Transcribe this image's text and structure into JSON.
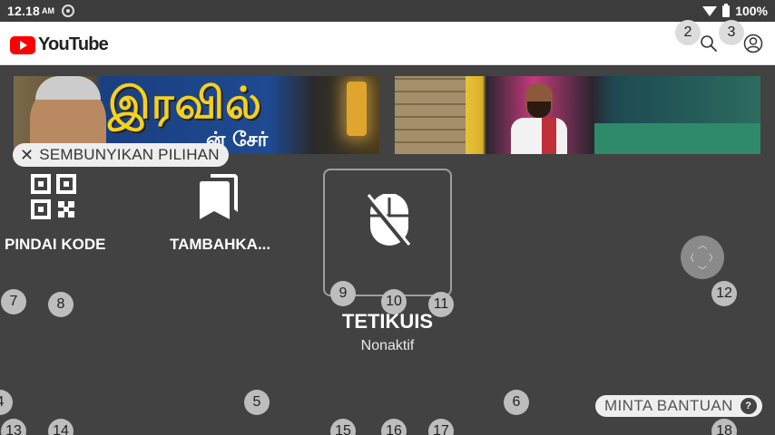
{
  "status_bar": {
    "time": "12.18",
    "ampm": "AM",
    "battery": "100%"
  },
  "app": {
    "logo_text": "YouTube",
    "icons": [
      "youtube-logo-icon",
      "search-icon",
      "account-icon"
    ]
  },
  "thumbnails": [
    {
      "title_text": "இரவில்",
      "subtitle_text": "ன் சேர்"
    },
    {
      "title_text": ""
    }
  ],
  "overlay": {
    "hide_options": "SEMBUNYIKAN PILIHAN",
    "tiles": [
      {
        "label": "PINDAI KODE",
        "icon": "qr-code-icon"
      },
      {
        "label": "TAMBAHKA...",
        "icon": "bookmarks-icon"
      }
    ],
    "mouse": {
      "title": "TETIKUIS",
      "status": "Nonaktif",
      "icon": "mouse-off-icon"
    },
    "help": "MINTA BANTUAN",
    "help_icon": "?"
  },
  "markers": [
    "2",
    "3",
    "4",
    "5",
    "6",
    "7",
    "8",
    "9",
    "10",
    "11",
    "12",
    "13",
    "14",
    "15",
    "16",
    "17",
    "18"
  ],
  "colors": {
    "overlay_bg": "#424242",
    "youtube_red": "#ff0000",
    "marker_bg": "#bdbdbd"
  }
}
